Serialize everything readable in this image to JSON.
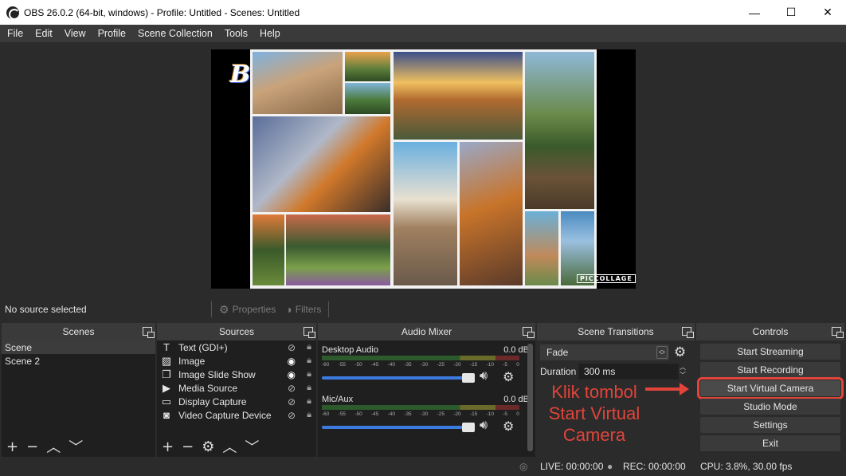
{
  "window": {
    "title": "OBS 26.0.2 (64-bit, windows) - Profile: Untitled - Scenes: Untitled",
    "min": "—",
    "max": "☐",
    "close": "✕"
  },
  "menu": [
    "File",
    "Edit",
    "View",
    "Profile",
    "Scene Collection",
    "Tools",
    "Help"
  ],
  "preview": {
    "watermark": "PICCOLLAGE",
    "logo_letter": "B"
  },
  "propbar": {
    "status": "No source selected",
    "properties": "Properties",
    "filters": "Filters"
  },
  "docks": {
    "scenes": "Scenes",
    "sources": "Sources",
    "mixer": "Audio Mixer",
    "transitions": "Scene Transitions",
    "controls": "Controls"
  },
  "scenes": [
    "Scene",
    "Scene 2"
  ],
  "sources": [
    {
      "name": "Text (GDI+)",
      "icon": "T",
      "visible": false
    },
    {
      "name": "Image",
      "icon": "▨",
      "visible": true
    },
    {
      "name": "Image Slide Show",
      "icon": "❐",
      "visible": true
    },
    {
      "name": "Media Source",
      "icon": "▶",
      "visible": false
    },
    {
      "name": "Display Capture",
      "icon": "▭",
      "visible": false
    },
    {
      "name": "Video Capture Device",
      "icon": "◙",
      "visible": false
    }
  ],
  "mixer": {
    "ticks": [
      "-60",
      "-55",
      "-50",
      "-45",
      "-40",
      "-35",
      "-30",
      "-25",
      "-20",
      "-15",
      "-10",
      "-5",
      "0"
    ],
    "channels": [
      {
        "name": "Desktop Audio",
        "db": "0.0 dB"
      },
      {
        "name": "Mic/Aux",
        "db": "0.0 dB"
      }
    ]
  },
  "transitions": {
    "selected": "Fade",
    "duration_label": "Duration",
    "duration": "300 ms"
  },
  "controls": [
    "Start Streaming",
    "Start Recording",
    "Start Virtual Camera",
    "Studio Mode",
    "Settings",
    "Exit"
  ],
  "annotation": {
    "line1": "Klik tombol",
    "line2": "Start Virtual",
    "line3": "Camera"
  },
  "status": {
    "live": "LIVE: 00:00:00",
    "rec": "REC: 00:00:00",
    "cpu": "CPU: 3.8%, 30.00 fps"
  },
  "colors": {
    "accent": "#3b7be0",
    "annotation": "#e2443a"
  }
}
